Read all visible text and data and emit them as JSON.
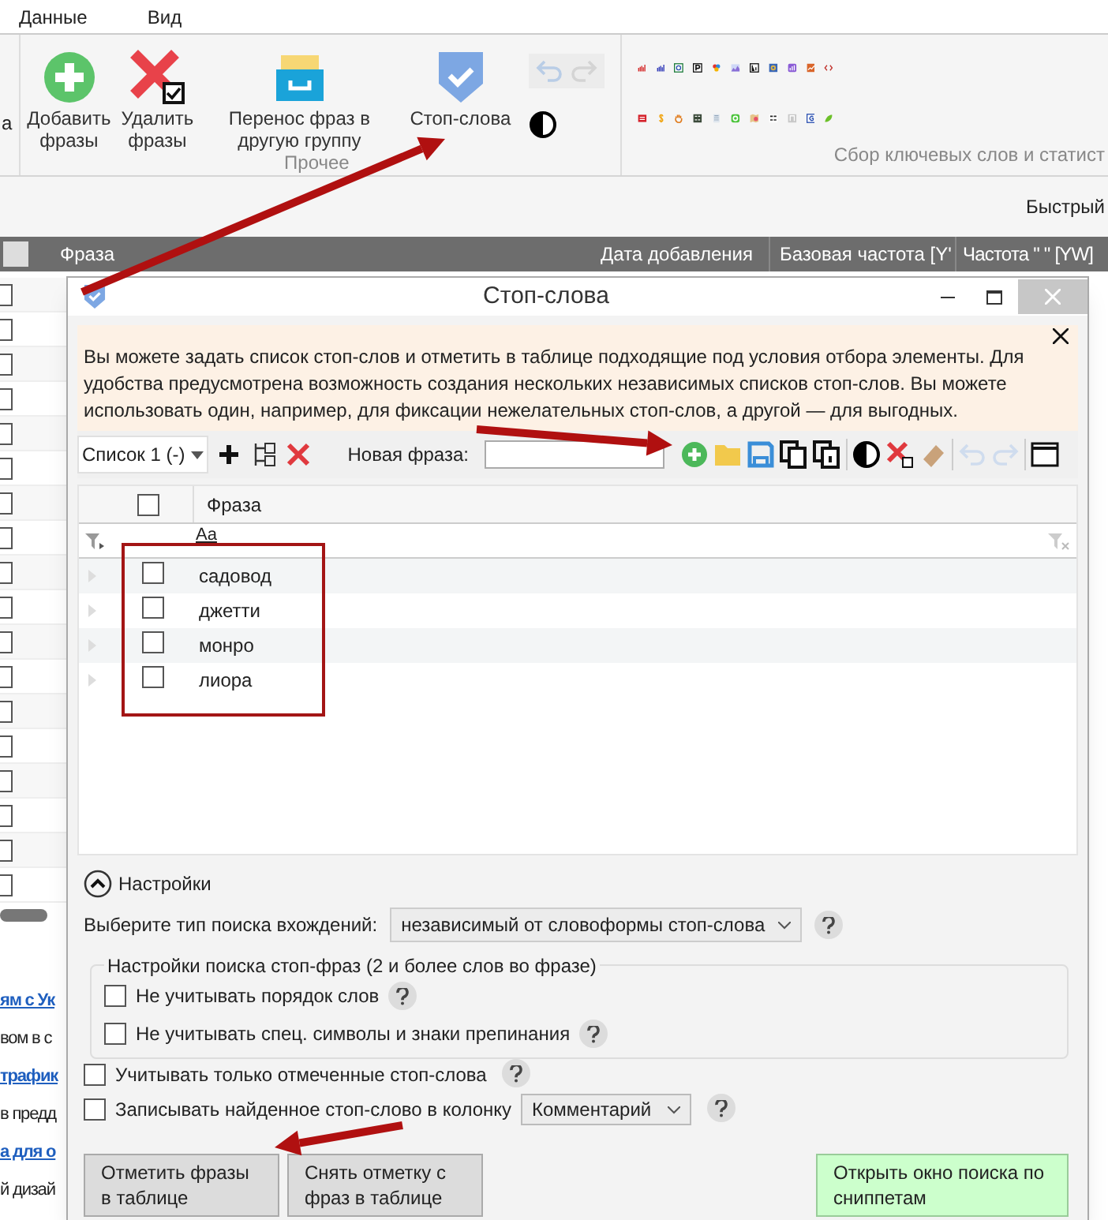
{
  "menu": [
    "Данные",
    "Вид"
  ],
  "ribbon": {
    "cut_left": "а",
    "buttons": [
      {
        "label": "Добавить фразы",
        "kind": "add"
      },
      {
        "label": "Удалить фразы",
        "kind": "delete"
      },
      {
        "label": "Перенос фраз в другую группу",
        "kind": "move"
      },
      {
        "label": "Стоп-слова",
        "kind": "stop"
      }
    ],
    "group_label": "Прочее",
    "group2_label": "Сбор ключевых слов и статист"
  },
  "quick_label": "Быстрый",
  "grid": {
    "columns": [
      "Фраза",
      "Дата добавления",
      "Базовая частота [Y'",
      "Частота \" \" [YW]"
    ],
    "rows": [
      {
        "checked": false
      },
      {
        "checked": false
      },
      {
        "checked": false
      },
      {
        "checked": false
      },
      {
        "checked": false
      },
      {
        "checked": false
      },
      {
        "checked": false
      },
      {
        "checked": false
      },
      {
        "checked": false
      },
      {
        "checked": false
      },
      {
        "checked": false
      },
      {
        "checked": false
      },
      {
        "checked": false
      },
      {
        "checked": false
      },
      {
        "checked": false
      },
      {
        "checked": false
      },
      {
        "checked": false
      },
      {
        "checked": false
      }
    ]
  },
  "side_texts": [
    {
      "text": "ям с Ук",
      "kind": "link"
    },
    {
      "text": "вом в с",
      "kind": "text"
    },
    {
      "text": "трафик",
      "kind": "link"
    },
    {
      "text": "в предд",
      "kind": "text"
    },
    {
      "text": "а для о",
      "kind": "link"
    },
    {
      "text": "й дизай",
      "kind": "text"
    }
  ],
  "dialog": {
    "title": "Стоп-слова",
    "info": "Вы можете задать список стоп-слов и отметить в таблице подходящие под условия отбора элементы. Для удобства предусмотрена возможность создания нескольких независимых списков стоп-слов. Вы можете использовать один, например, для фиксации нежелательных стоп-слов, а другой — для выгодных.",
    "list_select": "Список 1 (-)",
    "new_phrase_label": "Новая фраза:",
    "table": {
      "all_checked": false,
      "column": "Фраза",
      "filter": "Aa",
      "rows": [
        {
          "text": "садовод",
          "checked": false
        },
        {
          "text": "джетти",
          "checked": false
        },
        {
          "text": "монро",
          "checked": false
        },
        {
          "text": "лиора",
          "checked": false
        }
      ]
    },
    "settings": {
      "label": "Настройки",
      "expanded": true,
      "search_type_label": "Выберите тип поиска вхождений:",
      "search_type": "независимый от словоформы стоп-слова",
      "group_title": "Настройки поиска стоп-фраз (2 и более слов во фразе)",
      "group_options": [
        {
          "label": "Не учитывать порядок слов",
          "checked": false
        },
        {
          "label": "Не учитывать спец. символы и знаки препинания",
          "checked": false
        }
      ],
      "options": [
        {
          "label": "Учитывать только отмеченные стоп-слова",
          "checked": false
        },
        {
          "label": "Записывать найденное стоп-слово в колонку",
          "checked": false,
          "column_select": "Комментарий"
        }
      ]
    },
    "buttons": [
      {
        "label": "Отметить фразы в таблице",
        "kind": "default"
      },
      {
        "label": "Снять отметку с фраз в таблице",
        "kind": "default"
      },
      {
        "label": "Открыть окно поиска по сниппетам",
        "kind": "accent"
      }
    ]
  }
}
